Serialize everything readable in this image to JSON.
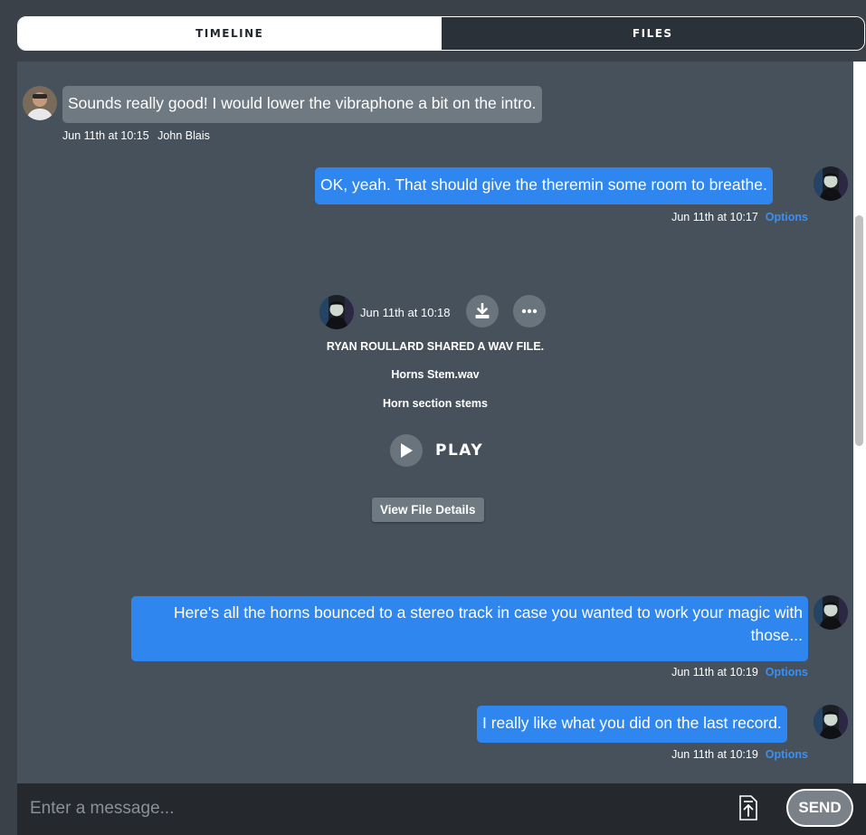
{
  "tabs": [
    {
      "label": "TIMELINE",
      "active": true
    },
    {
      "label": "FILES",
      "active": false
    }
  ],
  "messages": [
    {
      "text": "Sounds really good! I would lower the vibraphone a bit on the intro.",
      "timestamp": "Jun 11th at 10:15",
      "author": "John Blais",
      "direction": "incoming",
      "avatar_icon": "user-avatar-john"
    },
    {
      "text": "OK, yeah. That should give the theremin some room to breathe.",
      "timestamp": "Jun 11th at 10:17",
      "options_label": "Options",
      "direction": "outgoing",
      "avatar_icon": "user-avatar-ryan"
    },
    {
      "text": "Here's all the horns bounced to a stereo track in case you wanted to work your magic with those...",
      "timestamp": "Jun 11th at 10:19",
      "options_label": "Options",
      "direction": "outgoing",
      "avatar_icon": "user-avatar-ryan"
    },
    {
      "text": "I really like what you did on the last record.",
      "timestamp": "Jun 11th at 10:19",
      "options_label": "Options",
      "direction": "outgoing",
      "avatar_icon": "user-avatar-ryan"
    }
  ],
  "file_share": {
    "timestamp": "Jun 11th at 10:18",
    "shared_text": "RYAN ROULLARD SHARED A WAV FILE.",
    "file_name": "Horns Stem.wav",
    "description": "Horn section stems",
    "play_label": "PLAY",
    "details_label": "View File Details",
    "icons": [
      "download-icon",
      "more-options-icon",
      "play-icon"
    ]
  },
  "composer": {
    "placeholder": "Enter a message...",
    "send_label": "SEND",
    "attach_icon": "upload-file-icon"
  },
  "colors": {
    "outgoing_bubble": "#2f86ef",
    "incoming_bubble": "#6f7981",
    "chat_background": "#46515b",
    "options_link": "#3a8ff5"
  }
}
